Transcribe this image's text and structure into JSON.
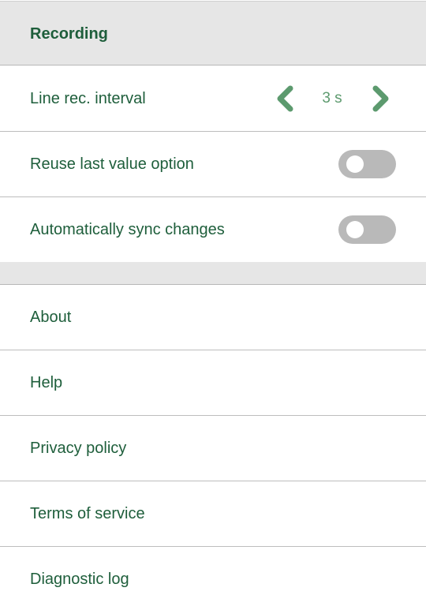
{
  "recording": {
    "title": "Recording",
    "line_interval": {
      "label": "Line rec. interval",
      "value": "3 s"
    },
    "reuse_last_value": {
      "label": "Reuse last value option",
      "enabled": false
    },
    "auto_sync": {
      "label": "Automatically sync changes",
      "enabled": false
    }
  },
  "menu": {
    "about": "About",
    "help": "Help",
    "privacy": "Privacy policy",
    "terms": "Terms of service",
    "diagnostic": "Diagnostic log"
  },
  "colors": {
    "accent": "#1e5e3b",
    "chevron": "#5c9a6e",
    "toggle_off": "#b9b9b9",
    "header_bg": "#e6e6e6"
  },
  "icons": {
    "prev": "chevron-left-icon",
    "next": "chevron-right-icon"
  }
}
